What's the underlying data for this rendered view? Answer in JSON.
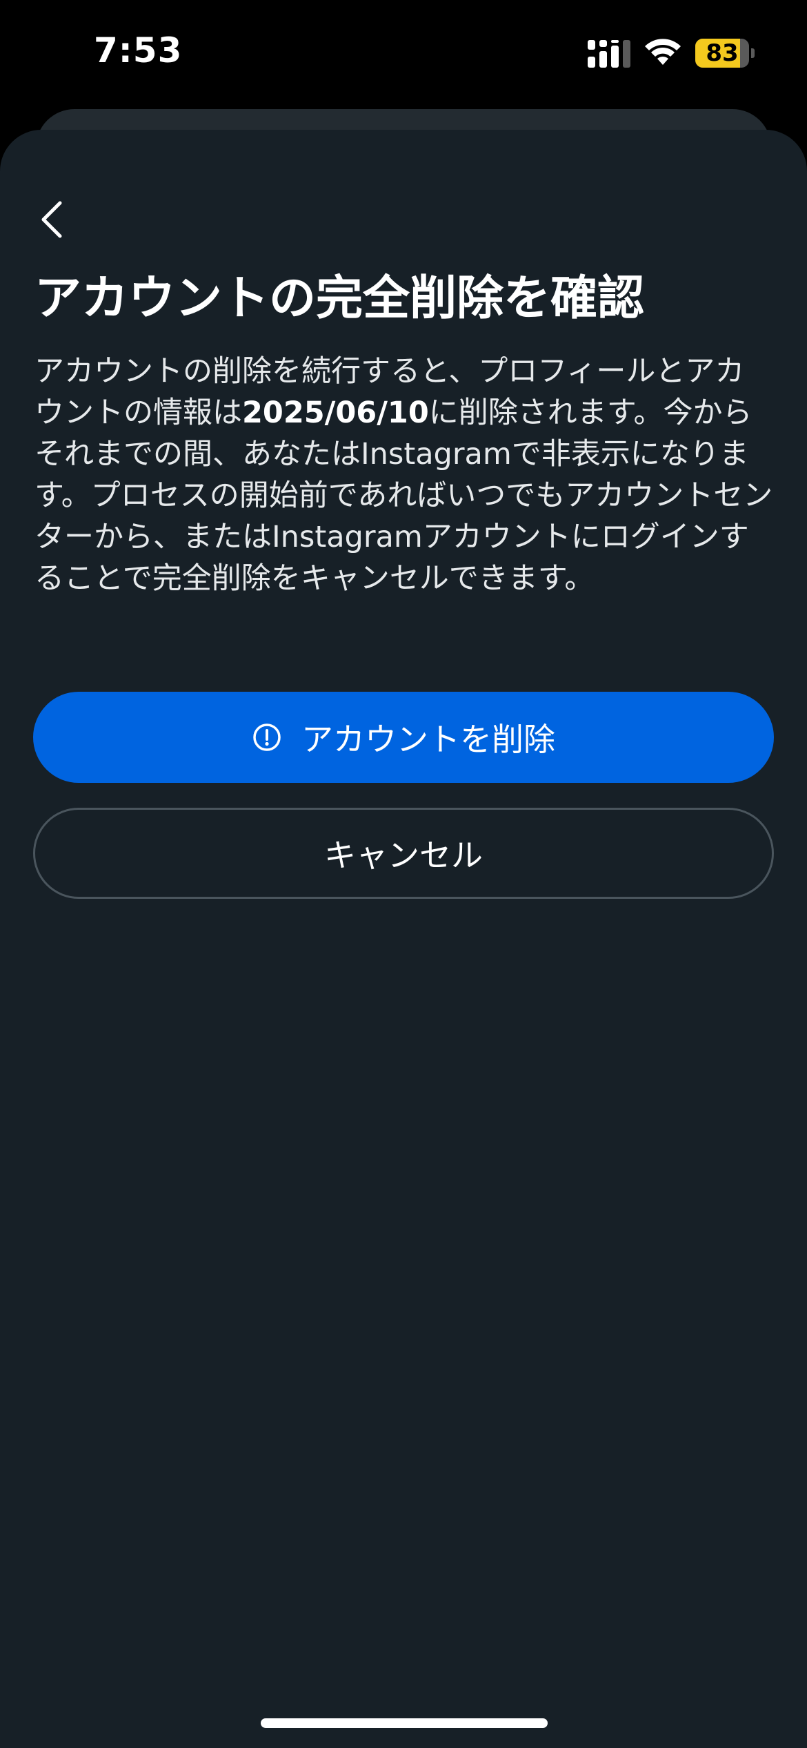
{
  "status_bar": {
    "time": "7:53",
    "battery_level": "83",
    "battery_percent": 83,
    "icons": [
      "signal-icon",
      "wifi-icon",
      "battery-icon"
    ]
  },
  "header": {
    "back_icon": "chevron-left-icon"
  },
  "main": {
    "title": "アカウントの完全削除を確認",
    "description_before_date": "アカウントの削除を続行すると、プロフィールとアカウントの情報は",
    "description_date": "2025/06/10",
    "description_after_date": "に削除されます。今からそれまでの間、あなたはInstagramで非表示になります。プロセスの開始前であればいつでもアカウントセンターから、またはInstagramアカウントにログインすることで完全削除をキャンセルできます。",
    "delete_button_label": "アカウントを削除",
    "delete_button_icon": "alert-circle-icon",
    "cancel_button_label": "キャンセル"
  },
  "colors": {
    "background": "#000000",
    "sheet": "#172027",
    "primary_button": "#0064e0",
    "battery": "#f4c91e"
  }
}
